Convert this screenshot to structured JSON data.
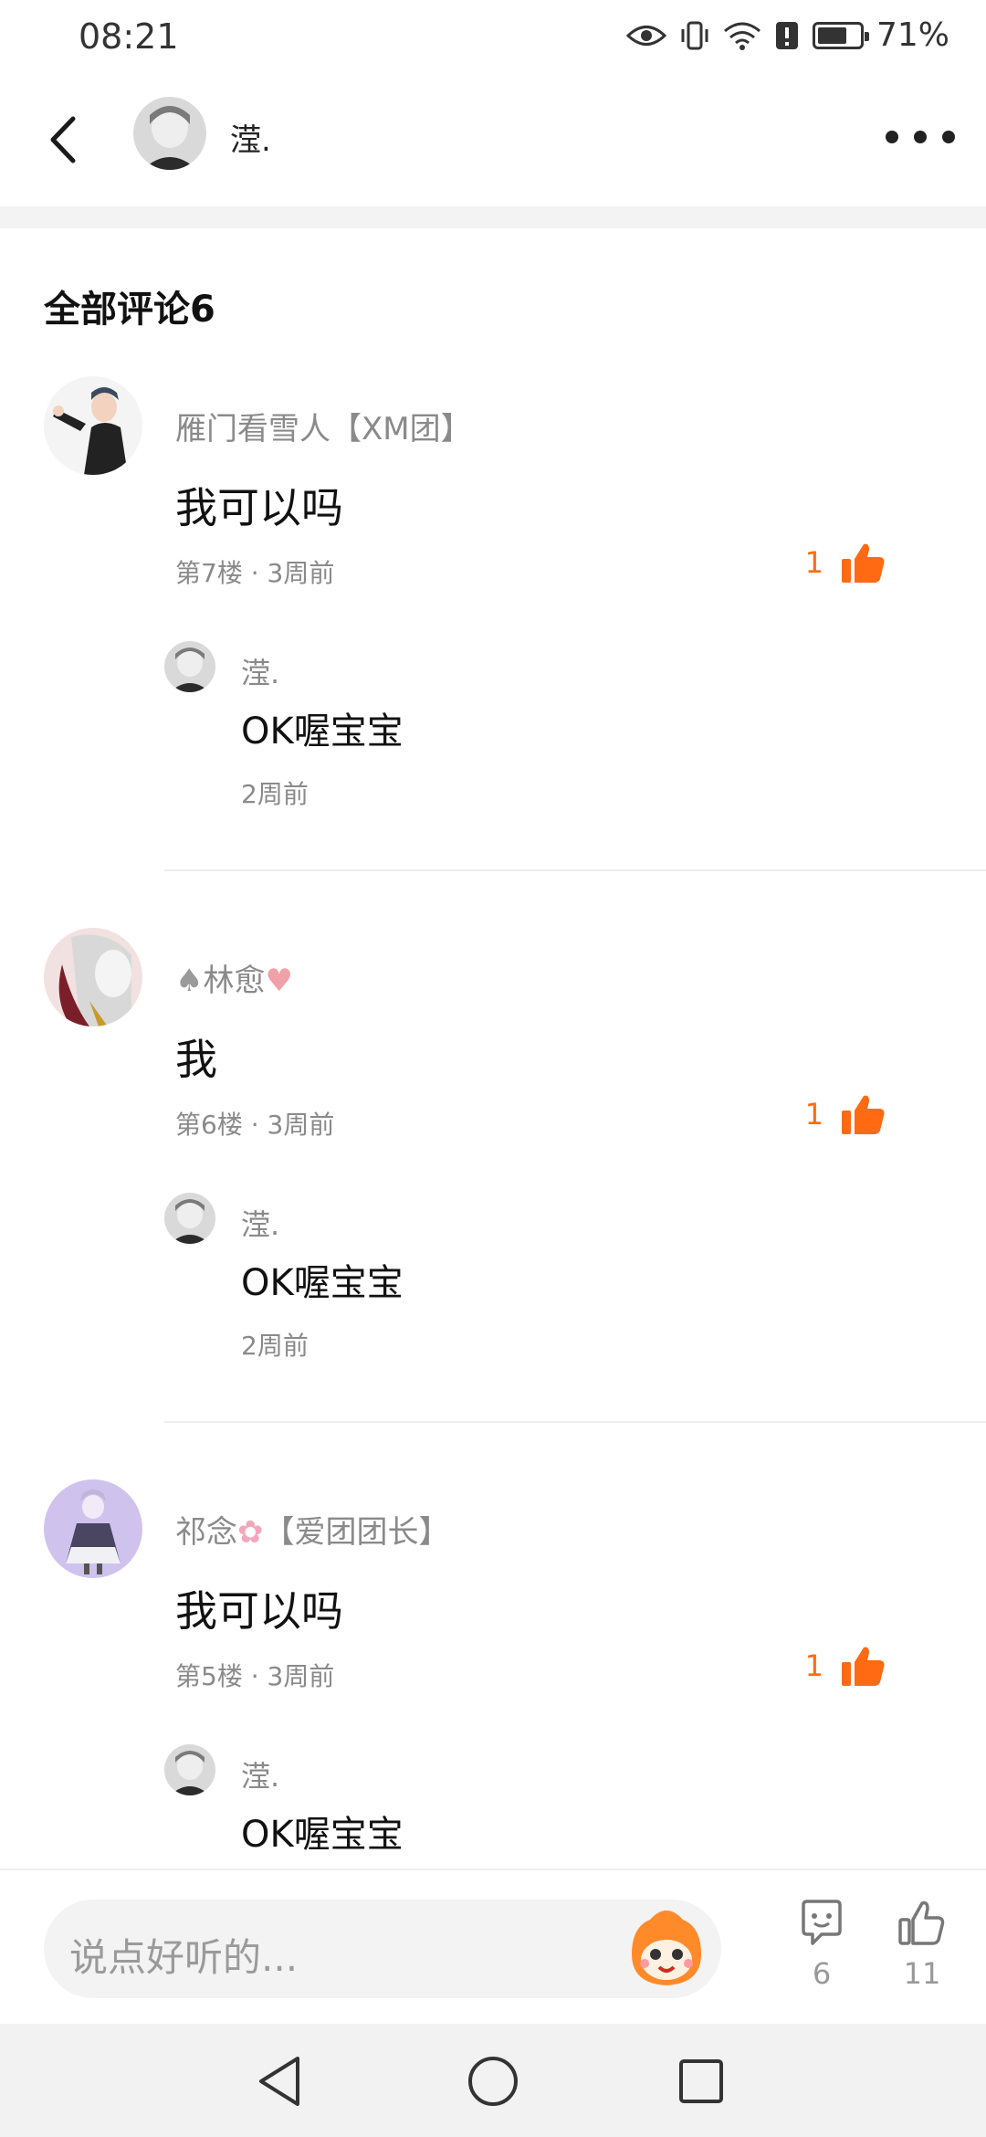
{
  "status_bar": {
    "time": "08:21",
    "battery_percent": "71%",
    "battery_level": 0.71
  },
  "header": {
    "user_name": "滢."
  },
  "comments_section": {
    "title": "全部评论6"
  },
  "comments": [
    {
      "author": "雁门看雪人【XM团】",
      "text": "我可以吗",
      "meta": "第7楼 · 3周前",
      "likes": "1",
      "reply": {
        "author": "滢.",
        "text": "OK喔宝宝",
        "time": "2周前"
      }
    },
    {
      "author": "林愈",
      "text": "我",
      "meta": "第6楼 · 3周前",
      "likes": "1",
      "reply": {
        "author": "滢.",
        "text": "OK喔宝宝",
        "time": "2周前"
      }
    },
    {
      "author": "祁念",
      "author_suffix": "【爱团团长】",
      "text": "我可以吗",
      "meta": "第5楼 · 3周前",
      "likes": "1",
      "reply": {
        "author": "滢.",
        "text": "OK喔宝宝"
      }
    }
  ],
  "input_bar": {
    "placeholder": "说点好听的...",
    "comment_count": "6",
    "like_count": "11"
  },
  "colors": {
    "accent": "#ff6a13",
    "muted_text": "#8a8a8a",
    "input_bg": "#f3f3f3"
  }
}
